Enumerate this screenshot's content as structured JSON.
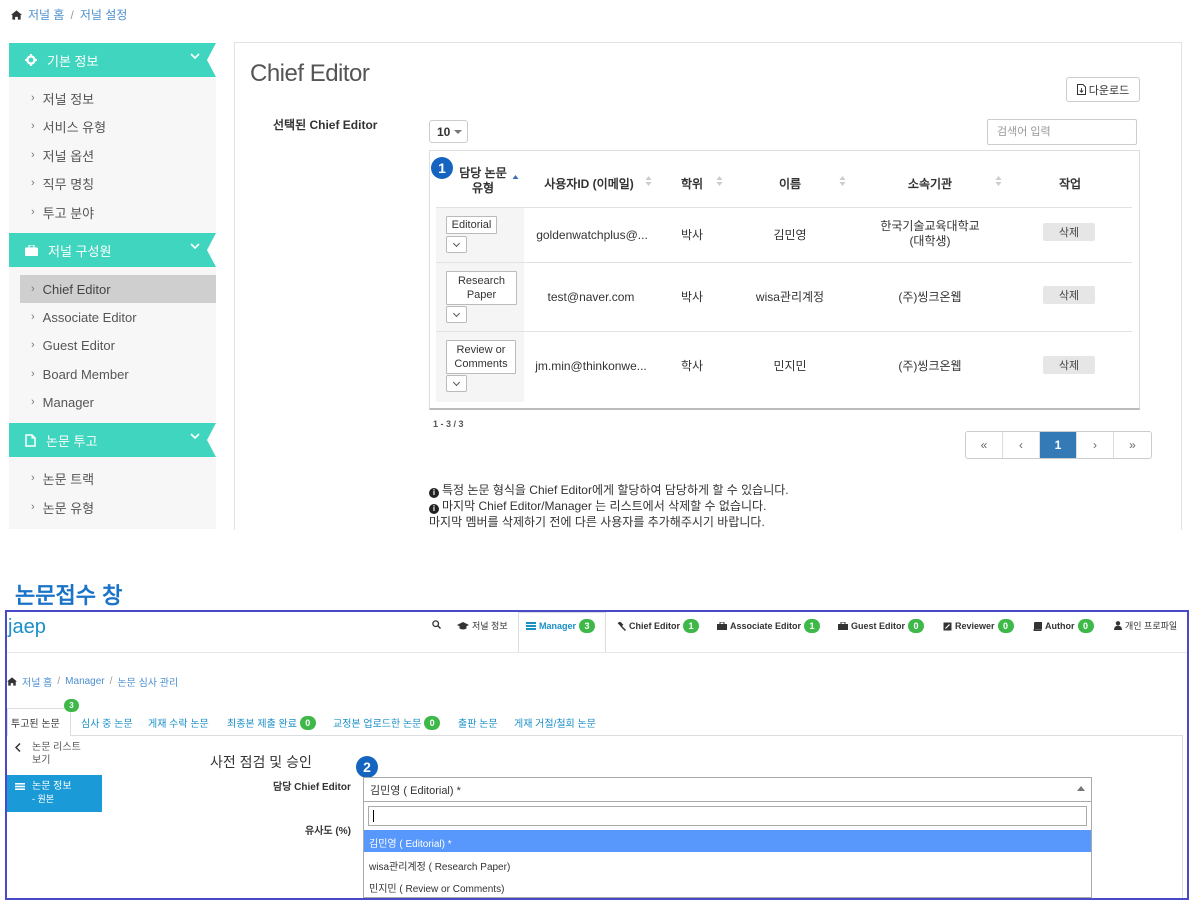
{
  "breadcrumb_top": {
    "home": "저널 홈",
    "current": "저널 설정"
  },
  "sidebar": {
    "sections": [
      {
        "label": "기본 정보",
        "items": [
          "저널 정보",
          "서비스 유형",
          "저널 옵션",
          "직무 명칭",
          "투고 분야"
        ]
      },
      {
        "label": "저널 구성원",
        "items": [
          "Chief Editor",
          "Associate Editor",
          "Guest Editor",
          "Board Member",
          "Manager"
        ]
      },
      {
        "label": "논문 투고",
        "items": [
          "논문 트랙",
          "논문 유형"
        ]
      }
    ],
    "active_item": "Chief Editor"
  },
  "main": {
    "title": "Chief Editor",
    "download_label": "다운로드",
    "selected_label": "선택된 Chief Editor",
    "page_length": "10",
    "search_placeholder": "검색어 입력",
    "columns": [
      "담당 논문 유형",
      "사용자ID (이메일)",
      "학위",
      "이름",
      "소속기관",
      "작업"
    ],
    "col0_line1": "담당 논문",
    "col0_line2": "유형",
    "rows": [
      {
        "type_l1": "Editorial",
        "type_l2": "",
        "email": "goldenwatchplus@...",
        "degree": "박사",
        "name": "김민영",
        "org_l1": "한국기술교육대학교",
        "org_l2": "(대학생)",
        "action": "삭제"
      },
      {
        "type_l1": "Research",
        "type_l2": "Paper",
        "email": "test@naver.com",
        "degree": "박사",
        "name": "wisa관리계정",
        "org_l1": "(주)씽크온웹",
        "org_l2": "",
        "action": "삭제"
      },
      {
        "type_l1": "Review or",
        "type_l2": "Comments",
        "email": "jm.min@thinkonwe...",
        "degree": "학사",
        "name": "민지민",
        "org_l1": "(주)씽크온웹",
        "org_l2": "",
        "action": "삭제"
      }
    ],
    "info": "1 - 3 / 3",
    "pager": {
      "first": "«",
      "prev": "‹",
      "current": "1",
      "next": "›",
      "last": "»"
    },
    "notes": [
      "특정 논문 형식을 Chief Editor에게 할당하여 담당하게 할 수 있습니다.",
      "마지막 Chief Editor/Manager 는 리스트에서 삭제할 수 없습니다.",
      "마지막 멤버를 삭제하기 전에 다른 사용자를 추가해주시기 바랍니다."
    ],
    "marker": "1"
  },
  "section_title": "논문접수 창",
  "app": {
    "logo": "jaep",
    "nav": [
      {
        "label": "저널 정보",
        "badge": "",
        "icon": "graduation-cap-icon"
      },
      {
        "label": "Manager",
        "badge": "3",
        "icon": "list-icon"
      },
      {
        "label": "Chief Editor",
        "badge": "1",
        "icon": "gavel-icon"
      },
      {
        "label": "Associate Editor",
        "badge": "1",
        "icon": "briefcase-icon"
      },
      {
        "label": "Guest Editor",
        "badge": "0",
        "icon": "briefcase-icon"
      },
      {
        "label": "Reviewer",
        "badge": "0",
        "icon": "edit-icon"
      },
      {
        "label": "Author",
        "badge": "0",
        "icon": "book-icon"
      },
      {
        "label": "개인 프로파일",
        "badge": "",
        "icon": "user-icon"
      }
    ],
    "breadcrumb": {
      "home": "저널 홈",
      "mid": "Manager",
      "current": "논문 심사 관리"
    },
    "tabs": [
      {
        "label": "투고된 논문",
        "badge": "3"
      },
      {
        "label": "심사 중 논문",
        "badge": ""
      },
      {
        "label": "게재 수락 논문",
        "badge": ""
      },
      {
        "label": "최종본 제출 완료",
        "badge": "0"
      },
      {
        "label": "교정본 업로드한 논문",
        "badge": "0"
      },
      {
        "label": "출판 논문",
        "badge": ""
      },
      {
        "label": "게재 거절/철회 논문",
        "badge": ""
      }
    ],
    "back_l1": "논문 리스트",
    "back_l2": "보기",
    "side_info_l1": "논문 정보",
    "side_info_l2": "- 원본",
    "pre_title": "사전 점검 및 승인",
    "chief_label": "담당 Chief Editor",
    "similarity_label": "유사도 (%)",
    "selected_value": "김민영  ( Editorial) *",
    "options": [
      "김민영  ( Editorial) *",
      "wisa관리계정  ( Research Paper)",
      "민지민  ( Review or Comments)"
    ],
    "marker": "2"
  }
}
